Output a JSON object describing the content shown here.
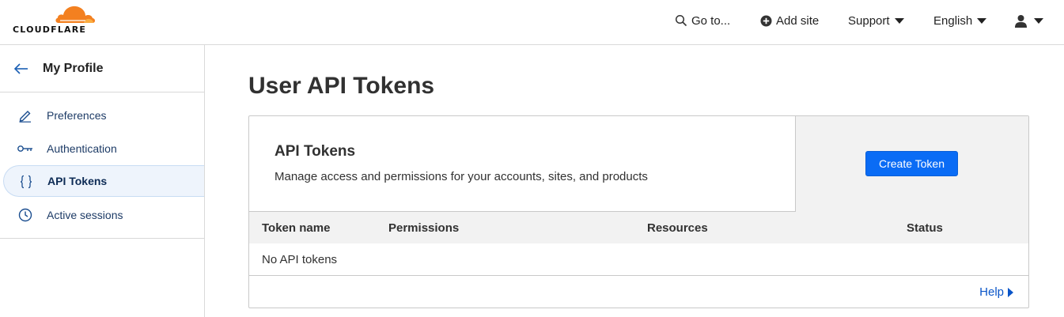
{
  "header": {
    "logo_text": "CLOUDFLARE",
    "goto_label": "Go to...",
    "add_site_label": "Add site",
    "support_label": "Support",
    "language_label": "English",
    "brand_color": "#f38020"
  },
  "sidebar": {
    "title": "My Profile",
    "items": [
      {
        "label": "Preferences",
        "icon": "pencil-icon",
        "active": false
      },
      {
        "label": "Authentication",
        "icon": "key-icon",
        "active": false
      },
      {
        "label": "API Tokens",
        "icon": "braces-icon",
        "active": true
      },
      {
        "label": "Active sessions",
        "icon": "clock-icon",
        "active": false
      }
    ]
  },
  "main": {
    "page_title": "User API Tokens",
    "panel": {
      "heading": "API Tokens",
      "description": "Manage access and permissions for your accounts, sites, and products",
      "create_button_label": "Create Token",
      "create_button_color": "#0a6cf5"
    },
    "table": {
      "columns": [
        "Token name",
        "Permissions",
        "Resources",
        "Status"
      ],
      "empty_message": "No API tokens"
    },
    "help_label": "Help"
  }
}
